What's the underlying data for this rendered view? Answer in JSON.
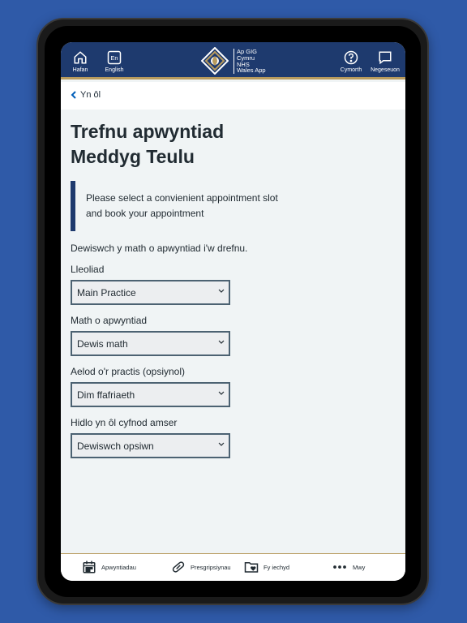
{
  "header": {
    "home_label": "Hafan",
    "lang_badge": "En",
    "lang_label": "English",
    "logo_line1": "Ap GIG",
    "logo_line2": "Cymru",
    "logo_line3": "NHS",
    "logo_line4": "Wales App",
    "help_label": "Cymorth",
    "messages_label": "Negeseuon"
  },
  "nav": {
    "back_label": "Yn ôl"
  },
  "page": {
    "title": "Trefnu apwyntiad Meddyg Teulu",
    "inset_text": "Please select a convienient appointment slot and book your appointment",
    "intro": "Dewiswch y math o apwyntiad i'w drefnu."
  },
  "form": {
    "fields": [
      {
        "label": "Lleoliad",
        "value": "Main Practice"
      },
      {
        "label": "Math o apwyntiad",
        "value": "Dewis math"
      },
      {
        "label": "Aelod o'r practis (opsiynol)",
        "value": "Dim ffafriaeth"
      },
      {
        "label": "Hidlo yn ôl cyfnod amser",
        "value": "Dewiswch opsiwn"
      }
    ]
  },
  "footer": {
    "appointments_label": "Apwyntiadau",
    "prescriptions_label": "Presgripsiynau",
    "health_label": "Fy iechyd",
    "more_label": "Mwy"
  },
  "colors": {
    "header_bg": "#1e3a6e",
    "accent_gold": "#b89b5e",
    "page_bg": "#f0f4f5",
    "backdrop": "#2f5aa8"
  }
}
